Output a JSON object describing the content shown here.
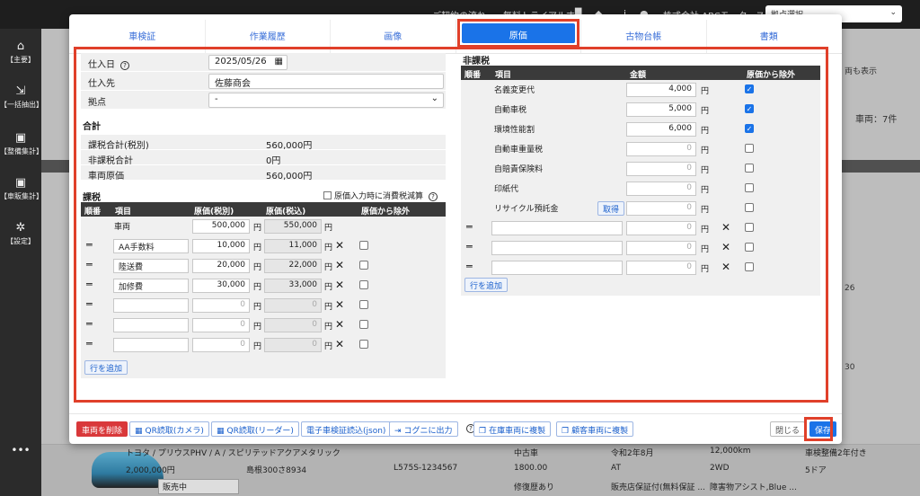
{
  "background": {
    "nav_links": [
      "ご契約の流れ",
      "無料トライアルする"
    ],
    "company": "株式会社 ABCモータース",
    "store_select": "拠点選択",
    "sidebar": [
      {
        "icon": "home-icon",
        "label": "【主要】"
      },
      {
        "icon": "export-icon",
        "label": "【一括抽出】"
      },
      {
        "icon": "car-icon",
        "label": "【整備集計】"
      },
      {
        "icon": "car-icon",
        "label": "【車販集計】"
      },
      {
        "icon": "gear-icon",
        "label": "【設定】"
      },
      {
        "icon": "more-icon",
        "label": "•••"
      }
    ],
    "right_texts": [
      "両も表示",
      "車両：7件",
      "26",
      "30"
    ],
    "row_texts": {
      "title": "トヨタ / プリウスPHV / A / スピリテッドアクアメタリック",
      "price": "2,000,000円",
      "plate": "島根300さ8934",
      "chassis": "L575S-1234567",
      "used": "中古車",
      "year": "令和2年8月",
      "km": "12,000km",
      "cc": "1800.00",
      "at": "AT",
      "wd": "2WD",
      "doors": "5ドア",
      "inspection": "車検整備2年付き",
      "status": "販売中",
      "repair": "修復歴あり",
      "warranty": "販売店保証付(無料保証 ...",
      "assist": "障害物アシスト,Blue ..."
    }
  },
  "tabs": [
    "車検証",
    "作業履歴",
    "画像",
    "原価",
    "古物台帳",
    "書類"
  ],
  "active_tab": "原価",
  "purchase": {
    "date_label": "仕入日",
    "date_value": "2025/05/26",
    "supplier_label": "仕入先",
    "supplier_value": "佐藤商会",
    "base_label": "拠点",
    "base_value": "-"
  },
  "totals": {
    "title": "合計",
    "rows": [
      {
        "label": "課税合計(税別)",
        "value": "560,000円"
      },
      {
        "label": "非課税合計",
        "value": "0円"
      },
      {
        "label": "車両原価",
        "value": "560,000円"
      }
    ]
  },
  "taxable": {
    "title": "課税",
    "option_label": "原価入力時に消費税減算",
    "headers": [
      "順番",
      "項目",
      "原価(税別)",
      "原価(税込)",
      "原価から除外"
    ],
    "rows": [
      {
        "name": "車両",
        "ex": "500,000",
        "inc": "550,000",
        "draggable": false
      },
      {
        "name": "AA手数料",
        "ex": "10,000",
        "inc": "11,000",
        "draggable": true
      },
      {
        "name": "陸送費",
        "ex": "20,000",
        "inc": "22,000",
        "draggable": true
      },
      {
        "name": "加修費",
        "ex": "30,000",
        "inc": "33,000",
        "draggable": true
      },
      {
        "name": "",
        "ex": "0",
        "inc": "0",
        "draggable": true
      },
      {
        "name": "",
        "ex": "0",
        "inc": "0",
        "draggable": true
      },
      {
        "name": "",
        "ex": "0",
        "inc": "0",
        "draggable": true
      }
    ],
    "yen": "円",
    "add_row": "行を追加"
  },
  "nontaxable": {
    "title": "非課税",
    "headers": [
      "順番",
      "項目",
      "金額",
      "原価から除外"
    ],
    "rows": [
      {
        "name": "名義変更代",
        "amount": "4,000",
        "excluded": true,
        "fixed": true
      },
      {
        "name": "自動車税",
        "amount": "5,000",
        "excluded": true,
        "fixed": true
      },
      {
        "name": "環境性能割",
        "amount": "6,000",
        "excluded": true,
        "fixed": true
      },
      {
        "name": "自動車重量税",
        "amount": "0",
        "excluded": false,
        "fixed": true
      },
      {
        "name": "自賠責保険料",
        "amount": "0",
        "excluded": false,
        "fixed": true
      },
      {
        "name": "印紙代",
        "amount": "0",
        "excluded": false,
        "fixed": true
      },
      {
        "name": "リサイクル預託金",
        "amount": "0",
        "excluded": false,
        "fixed": true,
        "button": "取得"
      },
      {
        "name": "",
        "amount": "0",
        "excluded": false,
        "fixed": false
      },
      {
        "name": "",
        "amount": "0",
        "excluded": false,
        "fixed": false
      },
      {
        "name": "",
        "amount": "0",
        "excluded": false,
        "fixed": false
      }
    ],
    "yen": "円",
    "add_row": "行を追加"
  },
  "footer": {
    "delete": "車両を削除",
    "qr_camera": "QR読取(カメラ)",
    "qr_reader": "QR読取(リーダー)",
    "ev_read": "電子車検証読込(json)",
    "cogni": "コグニに出力",
    "copy_stock": "在庫車両に複製",
    "copy_customer": "顧客車両に複製",
    "close": "閉じる",
    "save": "保存"
  }
}
